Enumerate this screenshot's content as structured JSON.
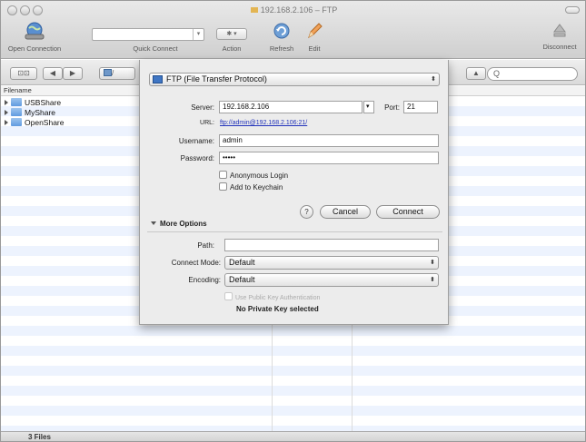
{
  "window": {
    "title": "192.168.2.106 – FTP"
  },
  "toolbar": {
    "open_connection": "Open Connection",
    "quick_connect": "Quick Connect",
    "action": "Action",
    "refresh": "Refresh",
    "edit": "Edit",
    "disconnect": "Disconnect",
    "action_glyph": "✱ ▾"
  },
  "pathbar": {
    "view_glyph": "⊡⊡",
    "back_glyph": "◀",
    "forward_glyph": "▶",
    "path_glyph": "/",
    "upload_glyph": "▲",
    "search_glyph": "Q"
  },
  "list": {
    "column_header": "Filename",
    "items": [
      {
        "name": "USBShare"
      },
      {
        "name": "MyShare"
      },
      {
        "name": "OpenShare"
      }
    ]
  },
  "status": {
    "count": "3 Files"
  },
  "dialog": {
    "protocol": "FTP (File Transfer Protocol)",
    "server_label": "Server:",
    "server_value": "192.168.2.106",
    "port_label": "Port:",
    "port_value": "21",
    "url_label": "URL:",
    "url_value": "ftp://admin@192.168.2.106:21/",
    "username_label": "Username:",
    "username_value": "admin",
    "password_label": "Password:",
    "password_value": "•••••",
    "anonymous_label": "Anonymous Login",
    "keychain_label": "Add to Keychain",
    "help_glyph": "?",
    "cancel_label": "Cancel",
    "connect_label": "Connect",
    "more_options_label": "More Options",
    "path_label": "Path:",
    "path_value": "",
    "connect_mode_label": "Connect Mode:",
    "connect_mode_value": "Default",
    "encoding_label": "Encoding:",
    "encoding_value": "Default",
    "public_key_label": "Use Public Key Authentication",
    "private_key_status": "No Private Key selected"
  },
  "colors": {
    "link": "#2233bb",
    "folder": "#5f9be0",
    "row_stripe": "#edf3fe"
  }
}
